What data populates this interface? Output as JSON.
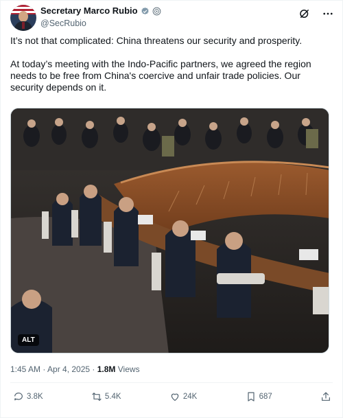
{
  "author": {
    "display_name": "Secretary Marco Rubio",
    "handle": "@SecRubio"
  },
  "header_icons": [
    "verified-badge-icon",
    "government-badge-icon",
    "grok-icon",
    "more-icon"
  ],
  "post": {
    "paragraph1": "It’s not that complicated: China threatens our security and prosperity.",
    "paragraph2": "At today’s meeting with the Indo-Pacific partners, we agreed the region needs to be free from China's coercive and unfair trade policies. Our security depends on it."
  },
  "media": {
    "alt_label": "ALT"
  },
  "meta": {
    "timestamp": "1:45 AM · Apr 4, 2025 · ",
    "views_count": "1.8M",
    "views_label": " Views"
  },
  "actions": {
    "replies": "3.8K",
    "reposts": "5.4K",
    "likes": "24K",
    "bookmarks": "687"
  },
  "colors": {
    "text": "#0f1419",
    "secondary": "#536471",
    "verified": "#829aab",
    "divider": "#eff3f4"
  }
}
